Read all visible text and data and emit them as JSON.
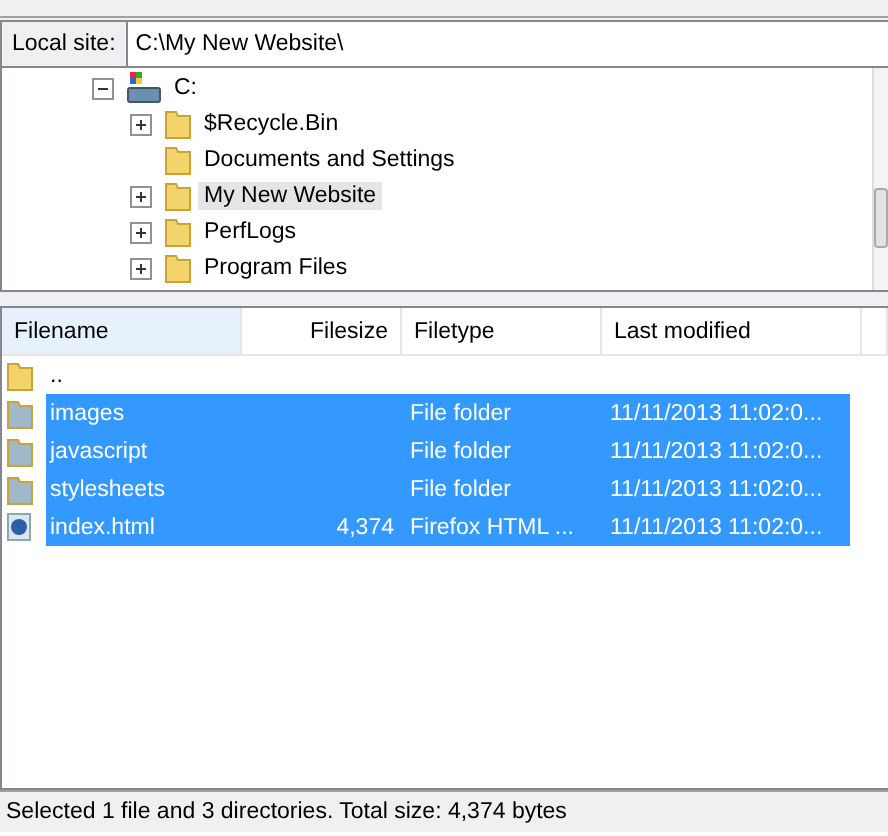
{
  "local_site": {
    "label": "Local site:",
    "value": "C:\\My New Website\\"
  },
  "tree": [
    {
      "label": "C:",
      "kind": "drive",
      "expanded": true,
      "children": [
        {
          "label": "$Recycle.Bin",
          "kind": "folder",
          "expanded": false,
          "selected": false
        },
        {
          "label": "Documents and Settings",
          "kind": "folder",
          "selected": false
        },
        {
          "label": "My New Website",
          "kind": "folder",
          "expanded": false,
          "selected": true
        },
        {
          "label": "PerfLogs",
          "kind": "folder",
          "expanded": false,
          "selected": false
        },
        {
          "label": "Program Files",
          "kind": "folder",
          "expanded": false,
          "selected": false
        }
      ]
    }
  ],
  "table": {
    "columns": [
      "Filename",
      "Filesize",
      "Filetype",
      "Last modified"
    ],
    "rows": [
      {
        "kind": "parent",
        "filename": "..",
        "selected": false
      },
      {
        "kind": "folder",
        "filename": "images",
        "filetype": "File folder",
        "modified": "11/11/2013 11:02:0...",
        "selected": true
      },
      {
        "kind": "folder",
        "filename": "javascript",
        "filetype": "File folder",
        "modified": "11/11/2013 11:02:0...",
        "selected": true
      },
      {
        "kind": "folder",
        "filename": "stylesheets",
        "filetype": "File folder",
        "modified": "11/11/2013 11:02:0...",
        "selected": true
      },
      {
        "kind": "file",
        "filename": "index.html",
        "filesize": "4,374",
        "filetype": "Firefox HTML ...",
        "modified": "11/11/2013 11:02:0...",
        "selected": true
      }
    ]
  },
  "status_bar": "Selected 1 file and 3 directories. Total size: 4,374 bytes"
}
